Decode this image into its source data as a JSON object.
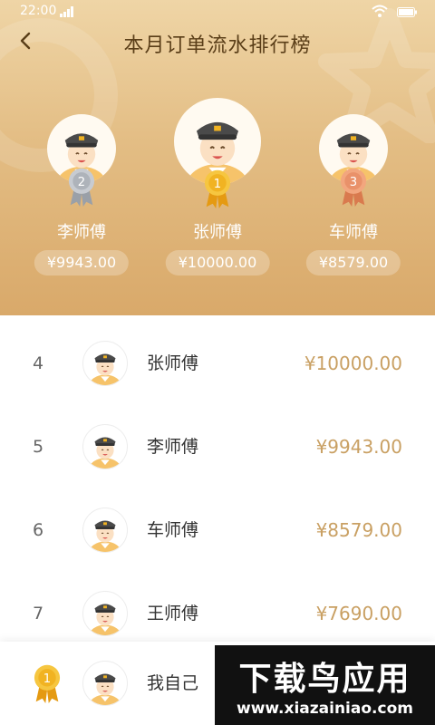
{
  "status_bar": {
    "time": "22:00"
  },
  "header": {
    "title": "本月订单流水排行榜"
  },
  "podium": [
    {
      "rank": 2,
      "name": "李师傅",
      "amount": "¥9943.00",
      "medal_color": "#b8bcc4"
    },
    {
      "rank": 1,
      "name": "张师傅",
      "amount": "¥10000.00",
      "medal_color": "#f1b322"
    },
    {
      "rank": 3,
      "name": "车师傅",
      "amount": "¥8579.00",
      "medal_color": "#e9916a"
    }
  ],
  "ranking": [
    {
      "rank": "4",
      "name": "张师傅",
      "amount": "¥10000.00"
    },
    {
      "rank": "5",
      "name": "李师傅",
      "amount": "¥9943.00"
    },
    {
      "rank": "6",
      "name": "车师傅",
      "amount": "¥8579.00"
    },
    {
      "rank": "7",
      "name": "王师傅",
      "amount": "¥7690.00"
    }
  ],
  "me": {
    "rank": "1",
    "name": "我自己"
  },
  "watermark": {
    "title": "下载鸟应用",
    "url": "www.xiazainiao.com"
  },
  "colors": {
    "accent": "#c9a063",
    "header_top": "#efd5a6",
    "header_bottom": "#d9a96a"
  }
}
